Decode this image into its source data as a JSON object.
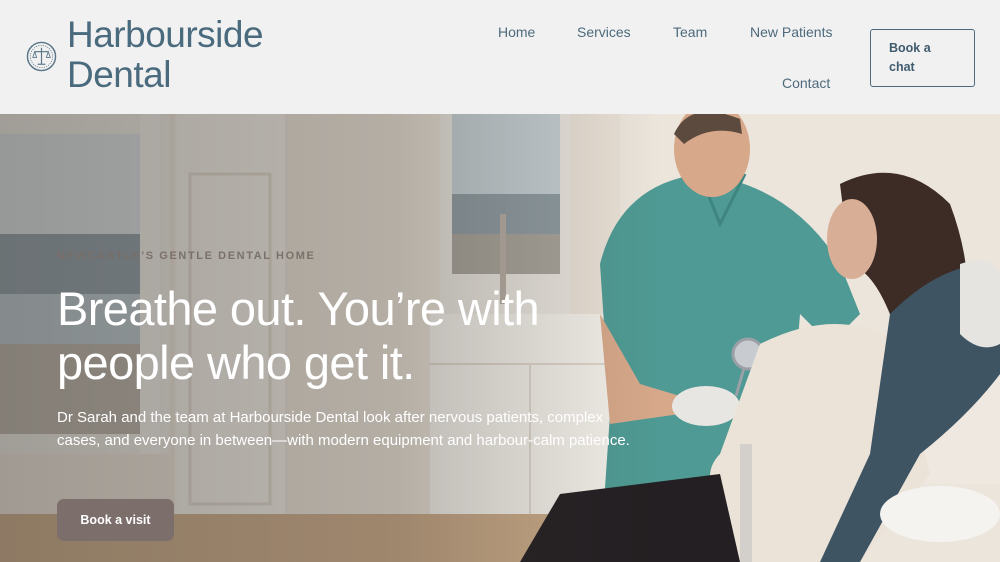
{
  "brand": {
    "line1": "Harbourside",
    "line2": "Dental",
    "logo_icon": "scales-of-justice-icon"
  },
  "nav": {
    "items": [
      "Home",
      "Services",
      "Team",
      "New Patients",
      "Contact"
    ],
    "book_chat_label": "Book a chat"
  },
  "hero": {
    "eyebrow": "NEWCASTLE’S GENTLE DENTAL HOME",
    "headline_line1": "Breathe out. You’re with",
    "headline_line2": "people who get it.",
    "lead": "Dr Sarah and the team at Harbourside Dental look after nervous patients, complex cases, and everyone in between—with modern equipment and harbour-calm patience.",
    "cta_label": "Book a visit"
  },
  "colors": {
    "brand": "#4a6a7e",
    "cta": "#7c6e6a",
    "header_bg": "#f1f1f1",
    "scrubs": "#4f9a94"
  }
}
